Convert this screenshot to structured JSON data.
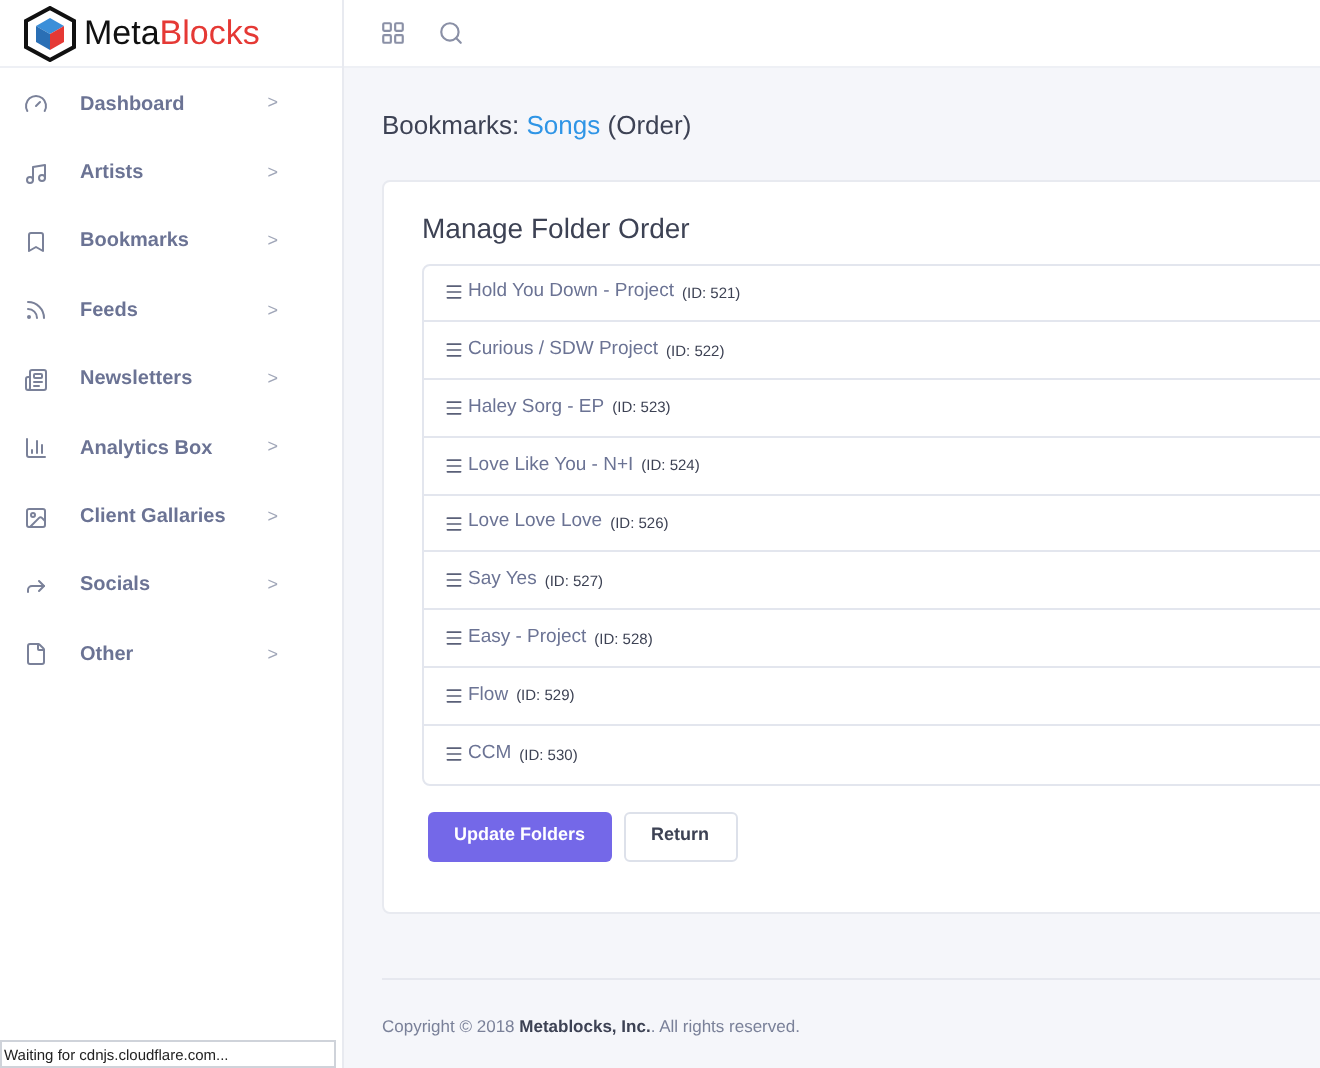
{
  "logo": {
    "dark_part": "Meta",
    "red_part": "Blocks"
  },
  "sidebar": {
    "items": [
      {
        "label": "Dashboard",
        "chevron": ">"
      },
      {
        "label": "Artists",
        "chevron": ">"
      },
      {
        "label": "Bookmarks",
        "chevron": ">"
      },
      {
        "label": "Feeds",
        "chevron": ">"
      },
      {
        "label": "Newsletters",
        "chevron": ">"
      },
      {
        "label": "Analytics Box",
        "chevron": ">"
      },
      {
        "label": "Client Gallaries",
        "chevron": ">"
      },
      {
        "label": "Socials",
        "chevron": ">"
      },
      {
        "label": "Other",
        "chevron": ">"
      }
    ]
  },
  "breadcrumb": {
    "prefix": "Bookmarks:",
    "link": "Songs",
    "suffix": "(Order)"
  },
  "card": {
    "title": "Manage Folder Order",
    "folders": [
      {
        "name": "Hold You Down - Project",
        "id_label": "(ID: 521)"
      },
      {
        "name": "Curious / SDW Project",
        "id_label": "(ID: 522)"
      },
      {
        "name": "Haley Sorg - EP",
        "id_label": "(ID: 523)"
      },
      {
        "name": "Love Like You - N+I",
        "id_label": "(ID: 524)"
      },
      {
        "name": "Love Love Love",
        "id_label": "(ID: 526)"
      },
      {
        "name": "Say Yes",
        "id_label": "(ID: 527)"
      },
      {
        "name": "Easy - Project",
        "id_label": "(ID: 528)"
      },
      {
        "name": "Flow",
        "id_label": "(ID: 529)"
      },
      {
        "name": "CCM",
        "id_label": "(ID: 530)"
      }
    ],
    "buttons": [
      {
        "label": "Update Folders",
        "kind": "primary"
      },
      {
        "label": "Return",
        "kind": "secondary"
      }
    ]
  },
  "footer": {
    "text": "Copyright © 2018 **Metablocks, Inc.**. All rights reserved."
  },
  "status_bar": {
    "text": "Waiting for cdnjs.cloudflare.com..."
  }
}
